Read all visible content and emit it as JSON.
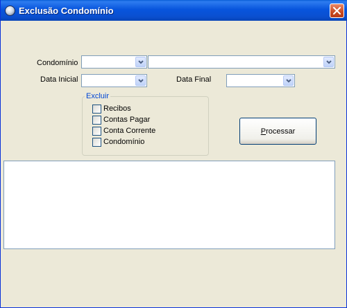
{
  "window": {
    "title": "Exclusão Condomínio"
  },
  "form": {
    "condominio_label": "Condomínio",
    "condominio_code_value": "",
    "condominio_name_value": "",
    "data_inicial_label": "Data Inicial",
    "data_inicial_value": "",
    "data_final_label": "Data Final",
    "data_final_value": ""
  },
  "excluir_group": {
    "legend": "Excluir",
    "options": [
      {
        "label": "Recibos",
        "checked": false
      },
      {
        "label": "Contas Pagar",
        "checked": false
      },
      {
        "label": "Conta Corrente",
        "checked": false
      },
      {
        "label": "Condomínio",
        "checked": false
      }
    ]
  },
  "actions": {
    "processar_label_first": "P",
    "processar_label_rest": "rocessar"
  },
  "log": {
    "text": ""
  },
  "icons": {
    "app": "app-icon",
    "close": "close-icon",
    "dropdown": "chevron-down-icon"
  },
  "colors": {
    "titlebar": "#0855dd",
    "background": "#ece9d8",
    "group_legend": "#0046d5",
    "input_border": "#7f9db9",
    "close_button": "#c94a22"
  }
}
